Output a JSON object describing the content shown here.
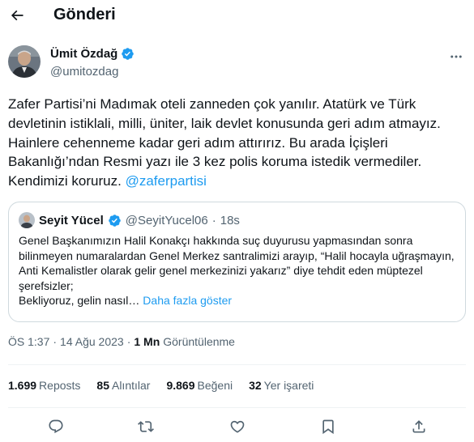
{
  "header": {
    "title": "Gönderi",
    "back_icon": "arrow-left-icon"
  },
  "author": {
    "name": "Ümit Özdağ",
    "handle": "@umitozdag",
    "verified": true,
    "verified_color": "#1d9bf0"
  },
  "tweet": {
    "text": "Zafer Partisi’ni Madımak oteli zanneden çok yanılır. Atatürk ve Türk devletinin istiklali, milli, üniter, laik devlet konusunda geri adım atmayız. Hainlere cehenneme kadar geri adım attırırız. Bu arada İçişleri Bakanlığı’ndan Resmi yazı ile 3 kez polis koruma istedik vermediler. Kendimizi koruruz.",
    "mention": "@zaferpartisi"
  },
  "quote": {
    "name": "Seyit Yücel",
    "handle": "@SeyitYucel06",
    "separator": "·",
    "time": "18s",
    "text": "Genel Başkanımızın Halil Konakçı hakkında suç duyurusu yapmasından sonra bilinmeyen numaralardan Genel Merkez santralimizi arayıp, “Halil hocayla uğraşmayın, Anti Kemalistler olarak gelir genel merkezinizi yakarız” diye tehdit eden müptezel şerefsizler;",
    "text_line2": "Bekliyoruz, gelin nasıl…",
    "more_label": "Daha fazla göster"
  },
  "meta": {
    "time": "ÖS 1:37",
    "sep": "·",
    "date": "14 Ağu 2023",
    "views_count": "1 Mn",
    "views_label": "Görüntülenme"
  },
  "stats": {
    "reposts_count": "1.699",
    "reposts_label": "Reposts",
    "quotes_count": "85",
    "quotes_label": "Alıntılar",
    "likes_count": "9.869",
    "likes_label": "Beğeni",
    "bookmarks_count": "32",
    "bookmarks_label": "Yer işareti"
  },
  "actions": [
    "reply-icon",
    "repost-icon",
    "like-icon",
    "bookmark-icon",
    "share-icon"
  ],
  "colors": {
    "accent": "#1d9bf0",
    "text": "#0f1419",
    "secondary": "#536471",
    "border": "#cfd9de"
  }
}
